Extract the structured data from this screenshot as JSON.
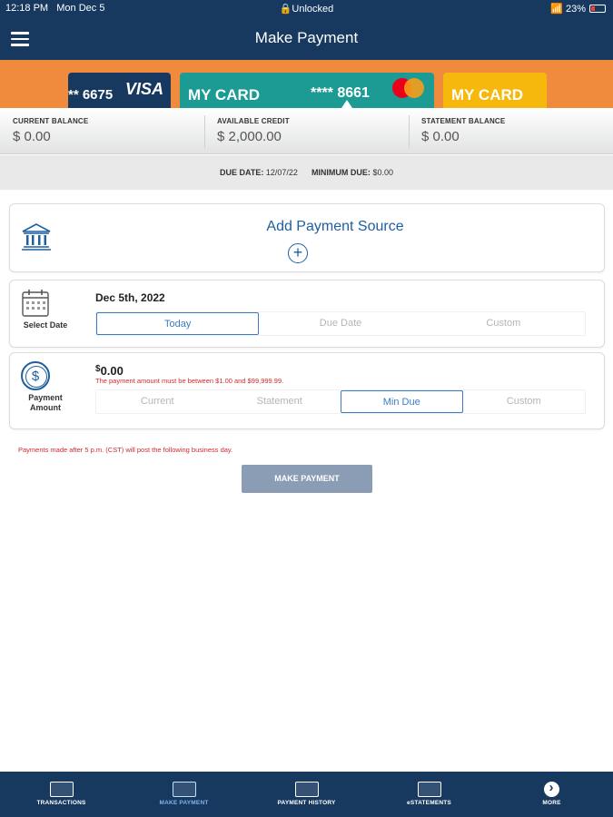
{
  "status_bar": {
    "time": "12:18 PM",
    "date": "Mon Dec 5",
    "lock": "Unlocked",
    "battery": "23%"
  },
  "header": {
    "title": "Make Payment"
  },
  "cards": [
    {
      "number": "** 6675",
      "brand": "VISA"
    },
    {
      "label": "MY CARD",
      "number": "**** 8661"
    },
    {
      "label": "MY CARD"
    }
  ],
  "balances": [
    {
      "label": "CURRENT BALANCE",
      "value": "$ 0.00"
    },
    {
      "label": "AVAILABLE CREDIT",
      "value": "$ 2,000.00"
    },
    {
      "label": "STATEMENT BALANCE",
      "value": "$ 0.00"
    }
  ],
  "due": {
    "due_label": "DUE DATE:",
    "due_value": "12/07/22",
    "min_label": "MINIMUM DUE:",
    "min_value": "$0.00"
  },
  "payment_source": {
    "label": "Add Payment Source"
  },
  "date_section": {
    "label": "Select Date",
    "value": "Dec 5th, 2022",
    "options": [
      "Today",
      "Due Date",
      "Custom"
    ],
    "selected": "Today"
  },
  "amount_section": {
    "label_line1": "Payment",
    "label_line2": "Amount",
    "currency": "$",
    "value": "0.00",
    "error": "The payment amount must be between $1.00 and $99,999.99.",
    "options": [
      "Current",
      "Statement",
      "Min Due",
      "Custom"
    ],
    "selected": "Min Due"
  },
  "cutoff_note": "Payments made after 5 p.m. (CST) will post the following business day.",
  "submit_button": "MAKE PAYMENT",
  "bottom_nav": [
    {
      "label": "TRANSACTIONS",
      "icon": "card-icon"
    },
    {
      "label": "MAKE PAYMENT",
      "icon": "card-payment-icon",
      "active": true
    },
    {
      "label": "PAYMENT HISTORY",
      "icon": "keyboard-icon"
    },
    {
      "label": "eSTATEMENTS",
      "icon": "statement-icon"
    },
    {
      "label": "MORE",
      "icon": "more-icon"
    }
  ],
  "colors": {
    "navy": "#17385f",
    "orange": "#f08a3c",
    "teal": "#1b9b93",
    "yellow": "#f6b80d",
    "link_blue": "#1e5fa0",
    "error_red": "#d12a2a",
    "button_gray": "#8a9db4"
  }
}
